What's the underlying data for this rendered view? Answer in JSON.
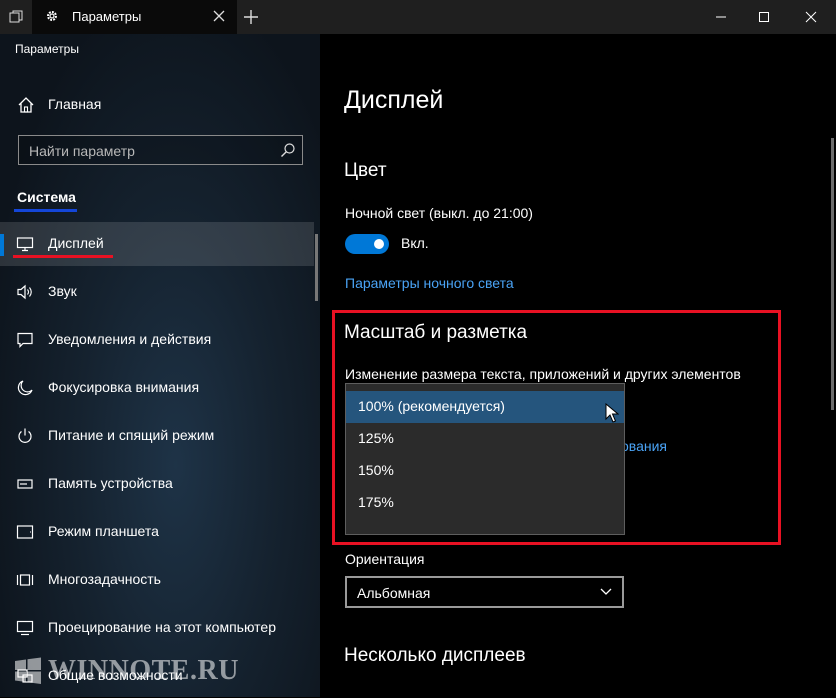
{
  "window": {
    "tab_title": "Параметры",
    "app_title": "Параметры"
  },
  "sidebar": {
    "home_label": "Главная",
    "search_placeholder": "Найти параметр",
    "section_title": "Система",
    "items": [
      {
        "label": "Дисплей",
        "icon": "monitor-icon",
        "active": true
      },
      {
        "label": "Звук",
        "icon": "speaker-icon"
      },
      {
        "label": "Уведомления и действия",
        "icon": "notification-icon"
      },
      {
        "label": "Фокусировка внимания",
        "icon": "moon-icon"
      },
      {
        "label": "Питание и спящий режим",
        "icon": "power-icon"
      },
      {
        "label": "Память устройства",
        "icon": "storage-icon"
      },
      {
        "label": "Режим планшета",
        "icon": "tablet-icon"
      },
      {
        "label": "Многозадачность",
        "icon": "multitask-icon"
      },
      {
        "label": "Проецирование на этот компьютер",
        "icon": "projection-icon"
      },
      {
        "label": "Общие возможности",
        "icon": "shared-icon"
      }
    ]
  },
  "watermark": "WINNOTE.RU",
  "main": {
    "page_title": "Дисплей",
    "color_heading": "Цвет",
    "night_light_label": "Ночной свет (выкл. до 21:00)",
    "night_light_state": "Вкл.",
    "night_light_link": "Параметры ночного света",
    "scale_heading": "Масштаб и разметка",
    "scale_description": "Изменение размера текста, приложений и других элементов",
    "scale_options": [
      "100% (рекомендуется)",
      "125%",
      "150%",
      "175%"
    ],
    "hidden_link_fragment": "ования",
    "orientation_label": "Ориентация",
    "orientation_value": "Альбомная",
    "multi_display_heading": "Несколько дисплеев"
  },
  "colors": {
    "accent": "#0078d7",
    "link": "#4aa3f5",
    "highlight_red": "#e81123",
    "highlight_blue": "#1446d8",
    "dropdown_selected": "#25557d"
  }
}
